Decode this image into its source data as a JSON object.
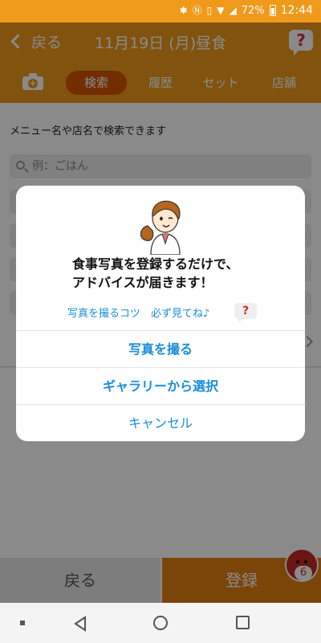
{
  "status_bar": {
    "battery": "72%",
    "time": "12:44"
  },
  "header": {
    "back_label": "戻る",
    "title": "11月19日 (月)昼食",
    "help_symbol": "?"
  },
  "tabs": [
    {
      "label": "検索",
      "active": true
    },
    {
      "label": "履歴",
      "active": false
    },
    {
      "label": "セット",
      "active": false
    },
    {
      "label": "店舗",
      "active": false
    }
  ],
  "content": {
    "hint": "メニュー名や店名で検索できます",
    "search_placeholder": "例：ごはん"
  },
  "dialog": {
    "message_line1": "食事写真を登録するだけで、",
    "message_line2": "アドバイスが届きます！",
    "tips_link": "写真を撮るコツ　必ず見てね♪",
    "tips_help_symbol": "?",
    "actions": {
      "take_photo": "写真を撮る",
      "choose_gallery": "ギャラリーから選択",
      "cancel": "キャンセル"
    }
  },
  "bottom_bar": {
    "back": "戻る",
    "register": "登録",
    "badge_count": "6"
  },
  "colors": {
    "brand_orange": "#ef9a1a",
    "accent_blue": "#1a8ddb",
    "active_tab": "#d35400",
    "help_red": "#d32f2f"
  }
}
